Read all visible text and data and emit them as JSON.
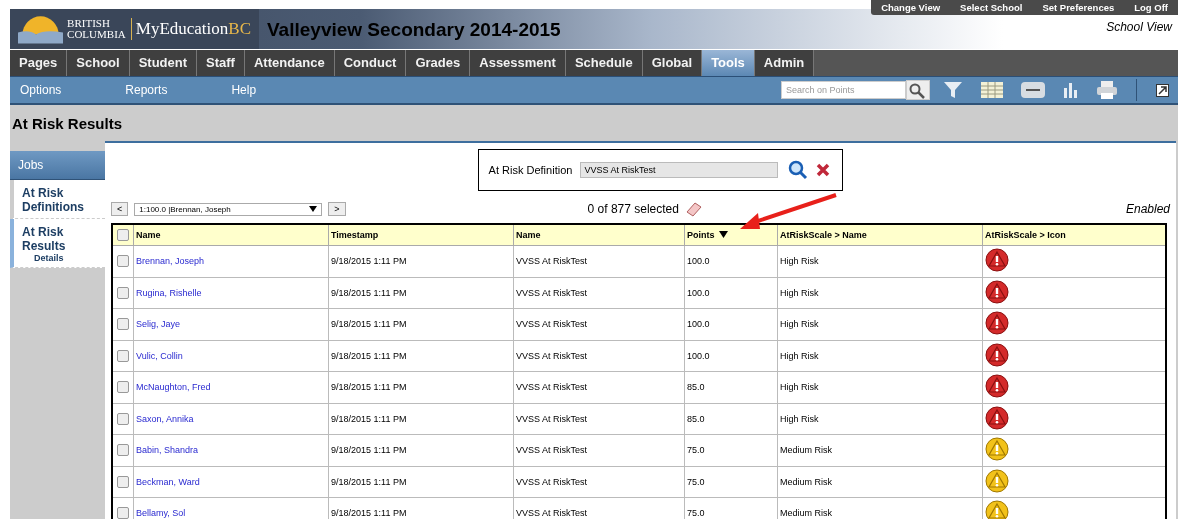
{
  "header": {
    "logo_top": "BRITISH",
    "logo_bottom": "COLUMBIA",
    "brand": "MyEducation",
    "brand_suffix": "BC",
    "school_title": "Valleyview Secondary 2014-2015",
    "links": [
      "Change View",
      "Select School",
      "Set Preferences",
      "Log Off"
    ],
    "view": "School View"
  },
  "tabs": [
    {
      "label": "Pages",
      "selected": false
    },
    {
      "label": "School",
      "selected": false
    },
    {
      "label": "Student",
      "selected": false
    },
    {
      "label": "Staff",
      "selected": false
    },
    {
      "label": "Attendance",
      "selected": false
    },
    {
      "label": "Conduct",
      "selected": false
    },
    {
      "label": "Grades",
      "selected": false
    },
    {
      "label": "Assessment",
      "selected": false
    },
    {
      "label": "Schedule",
      "selected": false
    },
    {
      "label": "Global",
      "selected": false
    },
    {
      "label": "Tools",
      "selected": true
    },
    {
      "label": "Admin",
      "selected": false
    }
  ],
  "menu": [
    "Options",
    "Reports",
    "Help"
  ],
  "search": {
    "placeholder": "Search on Points"
  },
  "page_title": "At Risk Results",
  "sidebar": {
    "heading": "Jobs",
    "items": [
      {
        "label": "At Risk Definitions",
        "selected": false
      },
      {
        "label": "At Risk Results",
        "selected": true,
        "children": [
          {
            "label": "Details"
          }
        ]
      }
    ]
  },
  "definition": {
    "label": "At Risk Definition",
    "value": "VVSS At RiskTest"
  },
  "navigator": {
    "value": "1:100.0 |Brennan, Joseph",
    "prev": "<",
    "next": ">"
  },
  "selection": "0 of 877 selected",
  "status": "Enabled",
  "table": {
    "select_all_checked": false,
    "columns": [
      "Name",
      "Timestamp",
      "Name",
      "Points",
      "AtRiskScale > Name",
      "AtRiskScale > Icon"
    ],
    "rows": [
      {
        "name": "Brennan, Joseph",
        "timestamp": "9/18/2015 1:11 PM",
        "definition": "VVSS At RiskTest",
        "points": "100.0",
        "scale": "High Risk",
        "kind": "high",
        "checked": false
      },
      {
        "name": "Rugina, Rishelle",
        "timestamp": "9/18/2015 1:11 PM",
        "definition": "VVSS At RiskTest",
        "points": "100.0",
        "scale": "High Risk",
        "kind": "high",
        "checked": false
      },
      {
        "name": "Selig, Jaye",
        "timestamp": "9/18/2015 1:11 PM",
        "definition": "VVSS At RiskTest",
        "points": "100.0",
        "scale": "High Risk",
        "kind": "high",
        "checked": false
      },
      {
        "name": "Vulic, Collin",
        "timestamp": "9/18/2015 1:11 PM",
        "definition": "VVSS At RiskTest",
        "points": "100.0",
        "scale": "High Risk",
        "kind": "high",
        "checked": false
      },
      {
        "name": "McNaughton, Fred",
        "timestamp": "9/18/2015 1:11 PM",
        "definition": "VVSS At RiskTest",
        "points": "85.0",
        "scale": "High Risk",
        "kind": "high",
        "checked": false
      },
      {
        "name": "Saxon, Annika",
        "timestamp": "9/18/2015 1:11 PM",
        "definition": "VVSS At RiskTest",
        "points": "85.0",
        "scale": "High Risk",
        "kind": "high",
        "checked": false
      },
      {
        "name": "Babin, Shandra",
        "timestamp": "9/18/2015 1:11 PM",
        "definition": "VVSS At RiskTest",
        "points": "75.0",
        "scale": "Medium Risk",
        "kind": "medium",
        "checked": false
      },
      {
        "name": "Beckman, Ward",
        "timestamp": "9/18/2015 1:11 PM",
        "definition": "VVSS At RiskTest",
        "points": "75.0",
        "scale": "Medium Risk",
        "kind": "medium",
        "checked": false
      },
      {
        "name": "Bellamy, Sol",
        "timestamp": "9/18/2015 1:11 PM",
        "definition": "VVSS At RiskTest",
        "points": "75.0",
        "scale": "Medium Risk",
        "kind": "medium",
        "checked": false
      }
    ]
  }
}
